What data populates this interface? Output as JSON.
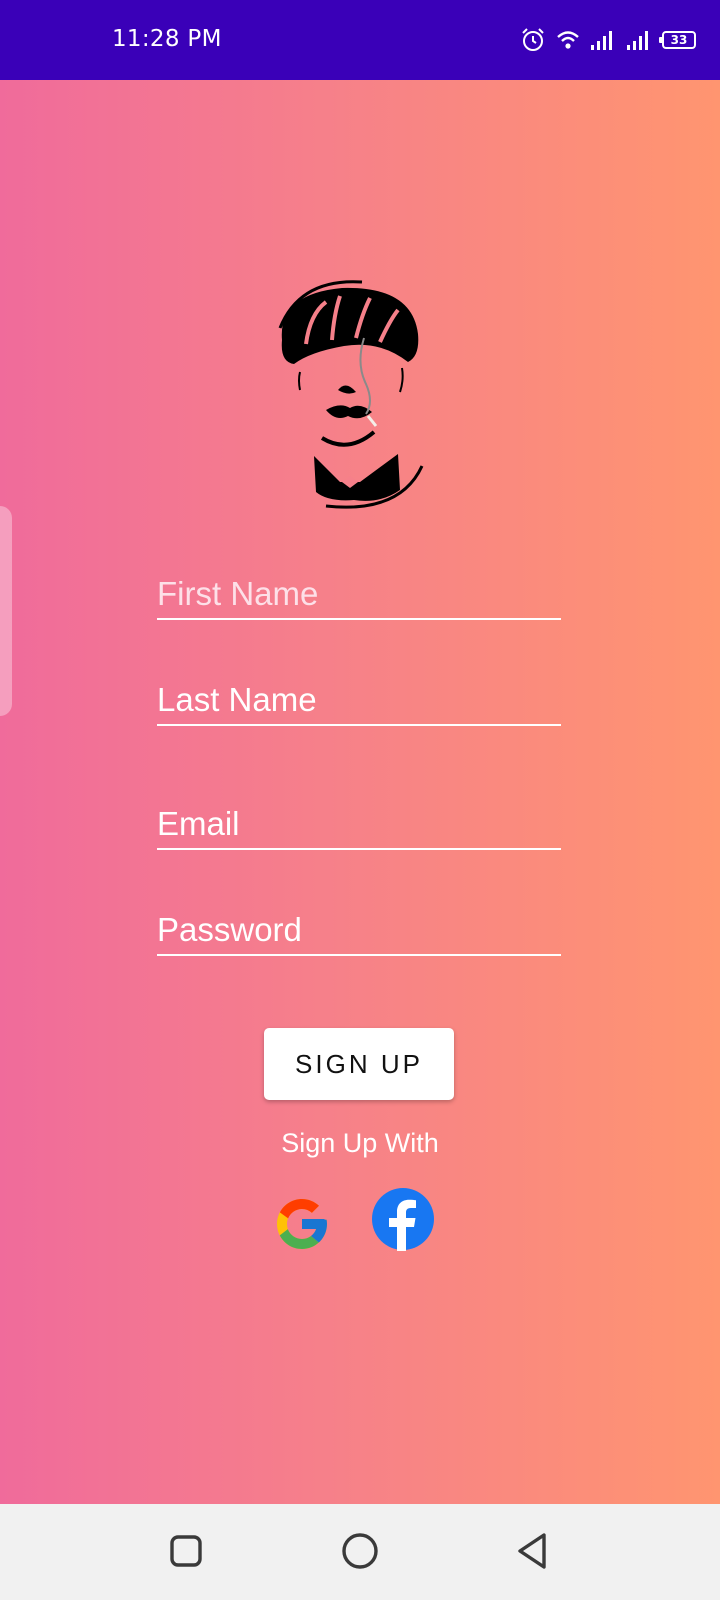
{
  "status_bar": {
    "time": "11:28 PM",
    "battery": "33",
    "icons": [
      "alarm-icon",
      "wifi-icon",
      "signal-icon",
      "signal-icon",
      "battery-icon"
    ],
    "background": "#3a00b8"
  },
  "form": {
    "first_name_placeholder": "First Name",
    "last_name_placeholder": "Last Name",
    "email_placeholder": "Email",
    "password_placeholder": "Password",
    "signup_label": "SIGN UP",
    "signup_with_label": "Sign Up With"
  },
  "social": [
    "google-icon",
    "facebook-icon"
  ],
  "nav_bar": {
    "buttons": [
      "recents-square-icon",
      "home-circle-icon",
      "back-triangle-icon"
    ]
  },
  "colors": {
    "gradient_start": "#f06b9b",
    "gradient_end": "#ff9570",
    "facebook_blue": "#1877f2"
  }
}
